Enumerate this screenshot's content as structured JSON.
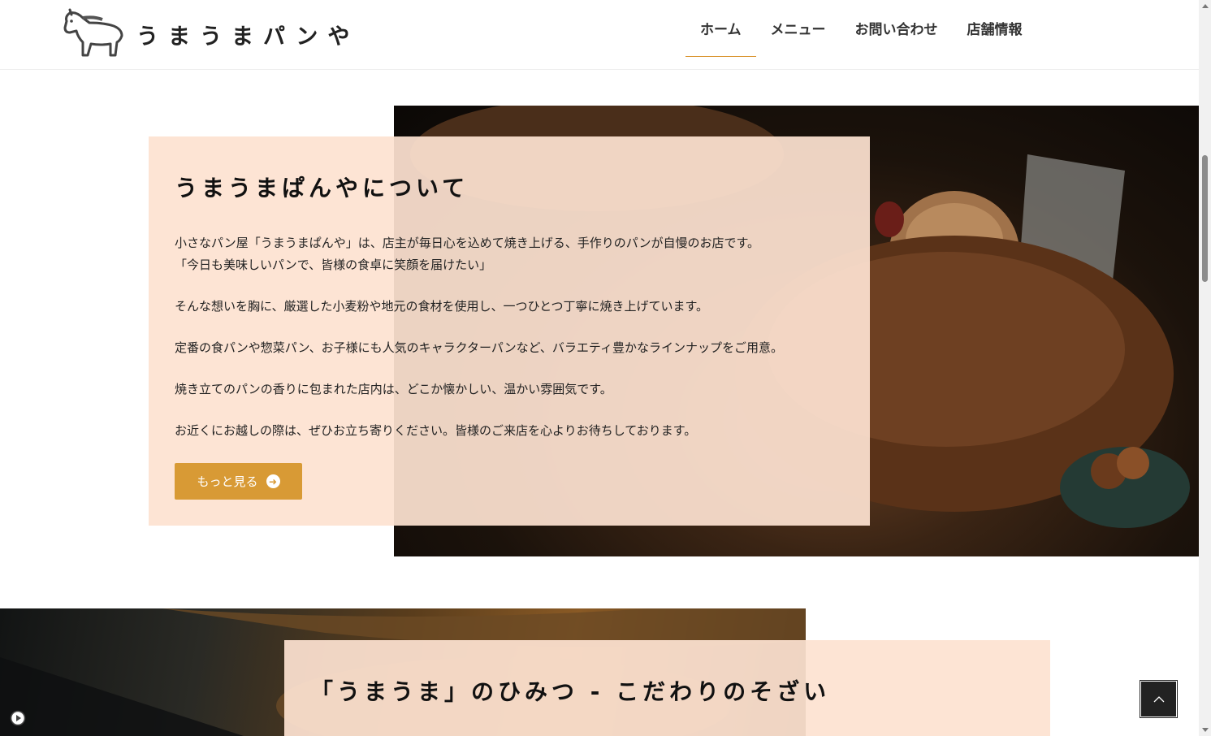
{
  "header": {
    "logo_text": "うまうまパンや",
    "nav": [
      {
        "label": "ホーム",
        "active": true
      },
      {
        "label": "メニュー",
        "active": false
      },
      {
        "label": "お問い合わせ",
        "active": false
      },
      {
        "label": "店舗情報",
        "active": false
      }
    ]
  },
  "about": {
    "title": "うまうまぱんやについて",
    "paragraphs": [
      "小さなパン屋「うまうまぱんや」は、店主が毎日心を込めて焼き上げる、手作りのパンが自慢のお店です。",
      "「今日も美味しいパンで、皆様の食卓に笑顔を届けたい」",
      "そんな想いを胸に、厳選した小麦粉や地元の食材を使用し、一つひとつ丁寧に焼き上げています。",
      "定番の食パンや惣菜パン、お子様にも人気のキャラクターパンなど、バラエティ豊かなラインナップをご用意。",
      "焼き立てのパンの香りに包まれた店内は、どこか懐かしい、温かい雰囲気です。",
      "お近くにお越しの際は、ぜひお立ち寄りください。皆様のご来店を心よりお待ちしております。"
    ],
    "more_button": "もっと見る"
  },
  "secret": {
    "title": "「うまうま」のひみつ - こだわりのそざい"
  },
  "colors": {
    "accent": "#d89a35",
    "card_bg": "#fde2d1"
  },
  "icons": {
    "logo": "horse-icon",
    "more": "arrow-right-circle-icon",
    "to_top": "chevron-up-icon",
    "media": "play-circle-icon"
  }
}
